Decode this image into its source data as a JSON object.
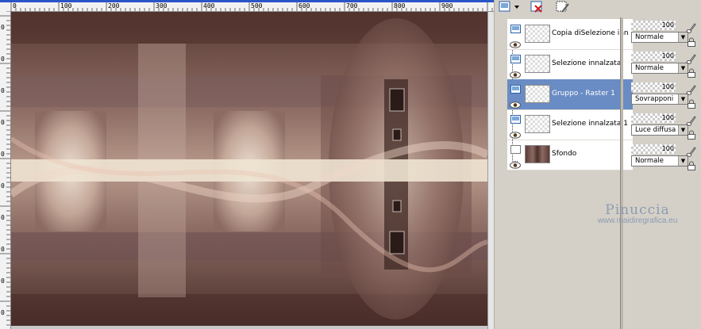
{
  "ruler": {
    "top_labels": [
      "0",
      "100",
      "200",
      "300",
      "400",
      "500",
      "600",
      "700",
      "800",
      "900"
    ],
    "left_labels": [
      "0",
      "0",
      "0",
      "0",
      "0",
      "0",
      "0",
      "0",
      "0",
      "0"
    ]
  },
  "toolbar": {
    "icons": [
      "new-layer-icon",
      "delete-layer-icon",
      "mask-icon"
    ]
  },
  "layers": [
    {
      "name": "Copia diSelezione inn",
      "type": "raster",
      "selected": false,
      "opacity": "100",
      "blend_mode": "Normale"
    },
    {
      "name": "Selezione innalzata",
      "type": "raster",
      "selected": false,
      "opacity": "100",
      "blend_mode": "Normale"
    },
    {
      "name": "Gruppo - Raster 1",
      "type": "group",
      "selected": true,
      "opacity": "100",
      "blend_mode": "Sovrapponi"
    },
    {
      "name": "Selezione innalzata 1",
      "type": "raster",
      "selected": false,
      "opacity": "100",
      "blend_mode": "Luce diffusa"
    },
    {
      "name": "Sfondo",
      "type": "background",
      "selected": false,
      "opacity": "100",
      "blend_mode": "Normale"
    }
  ],
  "watermark": {
    "name": "Pinuccia",
    "url": "www.maidiregrafica.eu"
  },
  "colors": {
    "selected_row": "#6a8cc4",
    "canvas_base": "#5a3b35",
    "canvas_cream": "#e8dcc8"
  }
}
